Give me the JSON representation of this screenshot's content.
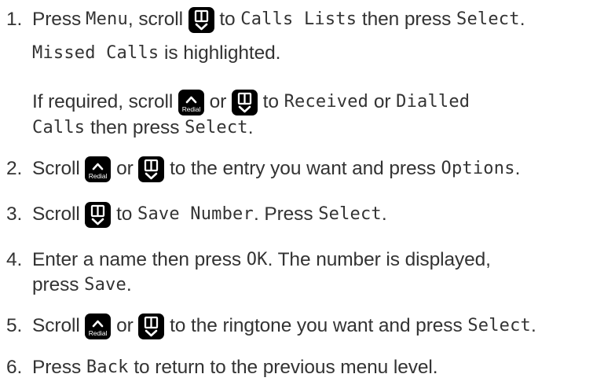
{
  "steps": [
    {
      "number": "1.",
      "lines": [
        {
          "parts": [
            {
              "t": "text",
              "v": "Press "
            },
            {
              "t": "lcd",
              "v": "Menu"
            },
            {
              "t": "text",
              "v": ", scroll "
            },
            {
              "t": "key",
              "icon": "phonebook-down-key-icon"
            },
            {
              "t": "text",
              "v": " to "
            },
            {
              "t": "lcd",
              "v": "Calls Lists"
            },
            {
              "t": "text",
              "v": " then press "
            },
            {
              "t": "lcd",
              "v": "Select"
            },
            {
              "t": "text",
              "v": "."
            }
          ]
        },
        {
          "parts": [
            {
              "t": "lcd",
              "v": "Missed Calls"
            },
            {
              "t": "text",
              "v": " is highlighted."
            }
          ]
        },
        {
          "parts": [
            {
              "t": "text",
              "v": "If required, scroll "
            },
            {
              "t": "key",
              "icon": "redial-up-key-icon",
              "label": "Redial"
            },
            {
              "t": "text",
              "v": " or "
            },
            {
              "t": "key",
              "icon": "phonebook-down-key-icon"
            },
            {
              "t": "text",
              "v": " to "
            },
            {
              "t": "lcd",
              "v": "Received"
            },
            {
              "t": "text",
              "v": " or "
            },
            {
              "t": "lcd",
              "v": "Dialled"
            }
          ]
        },
        {
          "parts": [
            {
              "t": "lcd",
              "v": "Calls"
            },
            {
              "t": "text",
              "v": " then press "
            },
            {
              "t": "lcd",
              "v": "Select"
            },
            {
              "t": "text",
              "v": "."
            }
          ]
        }
      ]
    },
    {
      "number": "2.",
      "lines": [
        {
          "parts": [
            {
              "t": "text",
              "v": "Scroll "
            },
            {
              "t": "key",
              "icon": "redial-up-key-icon",
              "label": "Redial"
            },
            {
              "t": "text",
              "v": " or "
            },
            {
              "t": "key",
              "icon": "phonebook-down-key-icon"
            },
            {
              "t": "text",
              "v": " to the entry you want and press "
            },
            {
              "t": "lcd",
              "v": "Options"
            },
            {
              "t": "text",
              "v": "."
            }
          ]
        }
      ]
    },
    {
      "number": "3.",
      "lines": [
        {
          "parts": [
            {
              "t": "text",
              "v": "Scroll "
            },
            {
              "t": "key",
              "icon": "phonebook-down-key-icon"
            },
            {
              "t": "text",
              "v": " to "
            },
            {
              "t": "lcd",
              "v": "Save Number"
            },
            {
              "t": "text",
              "v": ". Press "
            },
            {
              "t": "lcd",
              "v": "Select"
            },
            {
              "t": "text",
              "v": "."
            }
          ]
        }
      ]
    },
    {
      "number": "4.",
      "lines": [
        {
          "parts": [
            {
              "t": "text",
              "v": "Enter a name then press "
            },
            {
              "t": "lcd",
              "v": "OK"
            },
            {
              "t": "text",
              "v": ". The number is displayed,"
            }
          ]
        },
        {
          "parts": [
            {
              "t": "text",
              "v": "press "
            },
            {
              "t": "lcd",
              "v": "Save"
            },
            {
              "t": "text",
              "v": "."
            }
          ]
        }
      ]
    },
    {
      "number": "5.",
      "lines": [
        {
          "parts": [
            {
              "t": "text",
              "v": "Scroll "
            },
            {
              "t": "key",
              "icon": "redial-up-key-icon",
              "label": "Redial"
            },
            {
              "t": "text",
              "v": " or "
            },
            {
              "t": "key",
              "icon": "phonebook-down-key-icon"
            },
            {
              "t": "text",
              "v": " to the ringtone you want and press "
            },
            {
              "t": "lcd",
              "v": "Select"
            },
            {
              "t": "text",
              "v": "."
            }
          ]
        }
      ]
    },
    {
      "number": "6.",
      "lines": [
        {
          "parts": [
            {
              "t": "text",
              "v": "Press "
            },
            {
              "t": "lcd",
              "v": "Back"
            },
            {
              "t": "text",
              "v": " to return to the previous menu level."
            }
          ]
        }
      ]
    }
  ]
}
